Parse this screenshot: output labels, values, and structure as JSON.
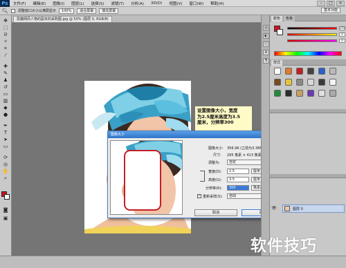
{
  "app": {
    "logo": "Ps"
  },
  "menu": [
    "文件(F)",
    "编辑(E)",
    "图像(I)",
    "图层(L)",
    "选择(S)",
    "滤镜(T)",
    "分析(A)",
    "3D(D)",
    "视图(V)",
    "窗口(W)",
    "帮助(H)"
  ],
  "options_bar": {
    "resize_windows": "调整窗口大小以满屏显示",
    "zoom": "100%",
    "btn_fit_screen": "适合屏幕",
    "btn_fill_screen": "填充屏幕",
    "workspace": "基本功能"
  },
  "document_tab": {
    "label": "思趣网风人物的副本的采购图.jpg @ 50% (图层 0, RGB/8)"
  },
  "callout": {
    "text": "设置图像大小，宽度\n为2.5厘米高度为3.5\n厘米，分辨率300"
  },
  "dialog": {
    "title": "图像大小",
    "close": "✕",
    "size_label": "图像大小:",
    "size_value": "356.9K (之前为3.36M)",
    "dims_label": "尺寸:",
    "dims_value": "295 像素 × 413 像素",
    "fit_label": "调整为:",
    "fit_value": "自定",
    "width_label": "宽度(D):",
    "width_value": "2.5",
    "width_unit": "厘米",
    "height_label": "高度(G):",
    "height_value": "3.5",
    "height_unit": "厘米",
    "res_label": "分辨率(R):",
    "res_value": "300",
    "res_unit": "像素/英寸",
    "resample_label": "重新采样(S):",
    "resample_value": "自动",
    "cancel": "取消",
    "ok": "确定"
  },
  "panels": {
    "color_tabs": [
      "颜色",
      "色板"
    ],
    "styles_tab": "样式",
    "slider_values": [
      "255",
      "0",
      "0"
    ],
    "layer_name": "图层 0"
  },
  "watermark": {
    "text": "软件技巧"
  },
  "colors": {
    "foreground": "#d0121c",
    "background": "#ffffff",
    "accent": "#2f73c7"
  }
}
